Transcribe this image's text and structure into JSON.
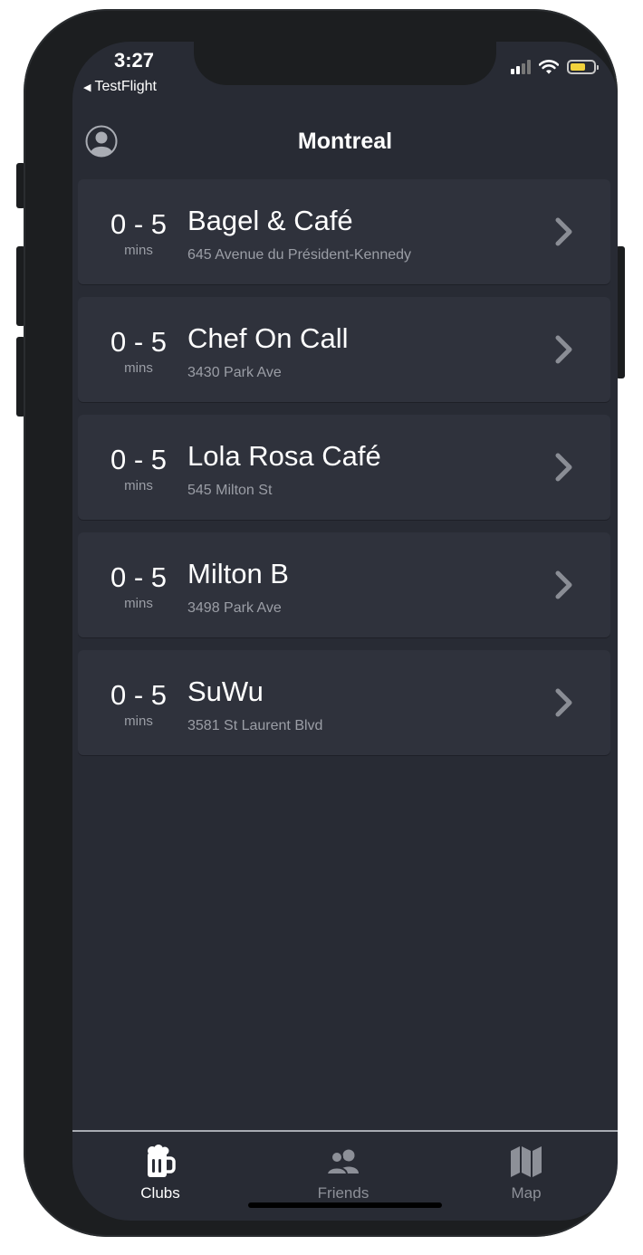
{
  "status_bar": {
    "time": "3:27",
    "back_app": "TestFlight"
  },
  "header": {
    "title": "Montreal",
    "profile_icon": "profile-icon"
  },
  "colors": {
    "background": "#282b34",
    "card": "#2f323c",
    "text_primary": "#ffffff",
    "text_secondary": "#9b9ea6",
    "battery": "#f2d23c"
  },
  "clubs": [
    {
      "eta": "0 - 5",
      "unit": "mins",
      "name": "Bagel & Café",
      "address": "645 Avenue du Président-Kennedy"
    },
    {
      "eta": "0 - 5",
      "unit": "mins",
      "name": "Chef On Call",
      "address": "3430 Park Ave"
    },
    {
      "eta": "0 - 5",
      "unit": "mins",
      "name": "Lola Rosa Café",
      "address": "545 Milton St"
    },
    {
      "eta": "0 - 5",
      "unit": "mins",
      "name": "Milton B",
      "address": "3498 Park Ave"
    },
    {
      "eta": "0 - 5",
      "unit": "mins",
      "name": "SuWu",
      "address": "3581 St Laurent Blvd"
    }
  ],
  "tabbar": {
    "items": [
      {
        "label": "Clubs",
        "icon": "beer-mug-icon",
        "active": true
      },
      {
        "label": "Friends",
        "icon": "friends-icon",
        "active": false
      },
      {
        "label": "Map",
        "icon": "map-icon",
        "active": false
      }
    ]
  }
}
